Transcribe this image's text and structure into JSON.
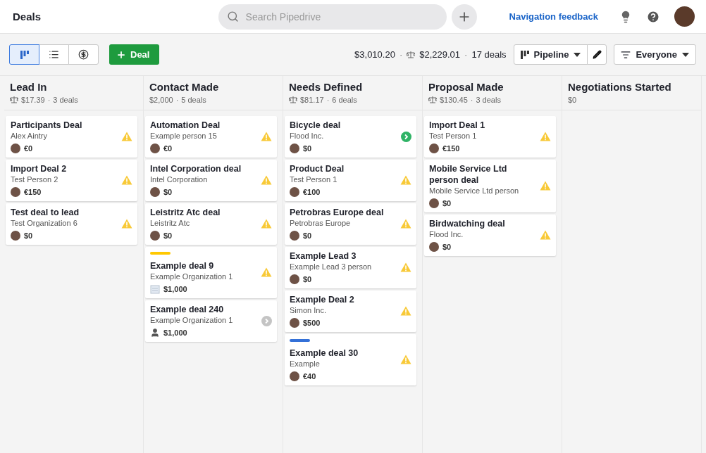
{
  "page_title": "Deals",
  "search": {
    "placeholder": "Search Pipedrive"
  },
  "feedback_link": "Navigation feedback",
  "views": [
    {
      "kind": "pipeline",
      "selected": true
    },
    {
      "kind": "list",
      "selected": false
    },
    {
      "kind": "forecast",
      "selected": false
    }
  ],
  "add_button": "Deal",
  "totals": {
    "amount": "$3,010.20",
    "separator_1": "·",
    "weighted": "$2,229.01",
    "separator_2": "·",
    "count": "17 deals"
  },
  "pipeline_select": "Pipeline",
  "owner_filter": "Everyone",
  "stages": [
    {
      "title": "Lead In",
      "weighted": true,
      "amount": "$17.39",
      "separator": "·",
      "count": "3 deals",
      "deals": [
        {
          "title": "Participants Deal",
          "subtitle": "Alex Aintry",
          "owner": {
            "kind": "photo"
          },
          "value": "€0",
          "kind": "warning"
        },
        {
          "title": "Import Deal 2",
          "subtitle": "Test Person 2",
          "owner": {
            "kind": "photo"
          },
          "value": "€150",
          "kind": "warning"
        },
        {
          "title": "Test deal to lead",
          "subtitle": "Test Organization 6",
          "owner": {
            "kind": "photo"
          },
          "value": "$0",
          "kind": "warning"
        }
      ]
    },
    {
      "title": "Contact Made",
      "weighted": false,
      "amount": "$2,000",
      "separator": "·",
      "count": "5 deals",
      "deals": [
        {
          "title": "Automation Deal",
          "subtitle": "Example person 15",
          "owner": {
            "kind": "photo"
          },
          "value": "€0",
          "kind": "warning"
        },
        {
          "title": "Intel Corporation deal",
          "subtitle": "Intel Corporation",
          "owner": {
            "kind": "photo"
          },
          "value": "$0",
          "kind": "warning"
        },
        {
          "title": "Leistritz Atc deal",
          "subtitle": "Leistritz Atc",
          "owner": {
            "kind": "photo"
          },
          "value": "$0",
          "kind": "warning"
        },
        {
          "title": "Example deal 9",
          "subtitle": "Example Organization 1",
          "owner": {
            "kind": "org"
          },
          "value": "$1,000",
          "kind": "warning",
          "color": "#ffc800"
        },
        {
          "title": "Example deal 240",
          "subtitle": "Example Organization 1",
          "owner": {
            "kind": "person"
          },
          "value": "$1,000",
          "kind": "idle"
        }
      ]
    },
    {
      "title": "Needs Defined",
      "weighted": true,
      "amount": "$81.17",
      "separator": "·",
      "count": "6 deals",
      "deals": [
        {
          "title": "Bicycle deal",
          "subtitle": "Flood Inc.",
          "owner": {
            "kind": "photo"
          },
          "value": "$0",
          "kind": "next"
        },
        {
          "title": "Product Deal",
          "subtitle": "Test Person 1",
          "owner": {
            "kind": "photo"
          },
          "value": "€100",
          "kind": "warning"
        },
        {
          "title": "Petrobras Europe deal",
          "subtitle": "Petrobras Europe",
          "owner": {
            "kind": "photo"
          },
          "value": "$0",
          "kind": "warning"
        },
        {
          "title": "Example Lead 3",
          "subtitle": "Example Lead 3 person",
          "owner": {
            "kind": "photo"
          },
          "value": "$0",
          "kind": "warning"
        },
        {
          "title": "Example Deal 2",
          "subtitle": "Simon Inc.",
          "owner": {
            "kind": "photo"
          },
          "value": "$500",
          "kind": "warning"
        },
        {
          "title": "Example deal 30",
          "subtitle": "Example",
          "owner": {
            "kind": "photo"
          },
          "value": "€40",
          "kind": "warning",
          "color": "#3471d8"
        }
      ]
    },
    {
      "title": "Proposal Made",
      "weighted": true,
      "amount": "$130.45",
      "separator": "·",
      "count": "3 deals",
      "deals": [
        {
          "title": "Import Deal 1",
          "subtitle": "Test Person 1",
          "owner": {
            "kind": "photo"
          },
          "value": "€150",
          "kind": "warning"
        },
        {
          "title": "Mobile Service Ltd person deal",
          "subtitle": "Mobile Service Ltd person",
          "owner": {
            "kind": "photo"
          },
          "value": "$0",
          "kind": "warning"
        },
        {
          "title": "Birdwatching deal",
          "subtitle": "Flood Inc.",
          "owner": {
            "kind": "photo"
          },
          "value": "$0",
          "kind": "warning"
        }
      ]
    },
    {
      "title": "Negotiations Started",
      "weighted": false,
      "amount": "$0"
    }
  ]
}
